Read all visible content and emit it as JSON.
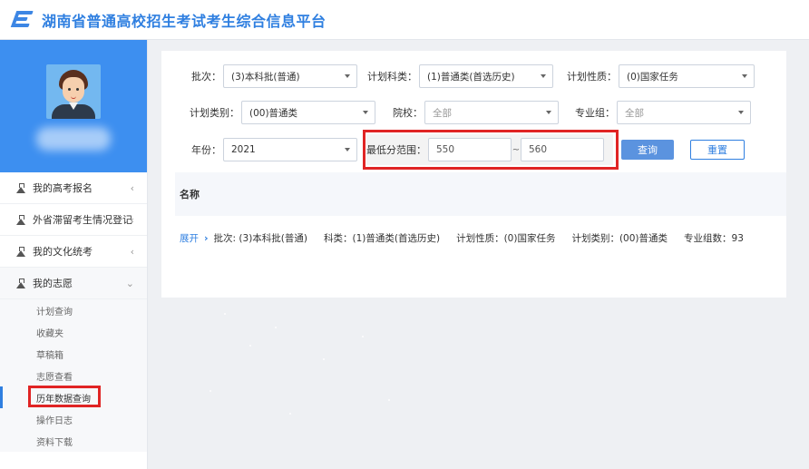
{
  "header": {
    "title": "湖南省普通高校招生考试考生综合信息平台",
    "logo_icon": "platform-logo-icon"
  },
  "sidebar": {
    "menu": [
      {
        "label": "我的高考报名",
        "arrow": "‹"
      },
      {
        "label": "外省滞留考生情况登记",
        "arrow": "‹"
      },
      {
        "label": "我的文化统考",
        "arrow": "‹"
      },
      {
        "label": "我的志愿",
        "arrow": "⌄"
      }
    ],
    "submenu": [
      "计划查询",
      "收藏夹",
      "草稿箱",
      "志愿查看",
      "历年数据查询",
      "操作日志",
      "资料下载"
    ]
  },
  "filters": {
    "batch_label": "批次：",
    "batch_value": "(3)本科批(普通)",
    "subject_label": "计划科类：",
    "subject_value": "(1)普通类(首选历史)",
    "nature_label": "计划性质：",
    "nature_value": "(0)国家任务",
    "category_label": "计划类别：",
    "category_value": "(00)普通类",
    "school_label": "院校：",
    "school_value": "全部",
    "group_label": "专业组：",
    "group_value": "全部",
    "year_label": "年份：",
    "year_value": "2021",
    "score_label": "最低分范围：",
    "score_min": "550",
    "score_sep": "~",
    "score_max": "560",
    "query_button": "查询",
    "reset_button": "重置"
  },
  "results": {
    "header": "名称",
    "expand": "展开",
    "chevron": "›",
    "batch": "批次: (3)本科批(普通)",
    "subject": "科类：(1)普通类(首选历史)",
    "nature": "计划性质：(0)国家任务",
    "category": "计划类别：(00)普通类",
    "group_count": "专业组数：93"
  },
  "colors": {
    "brand": "#2f7fe0",
    "sidebar_profile": "#3d8ff0",
    "highlight": "#e02424",
    "primary_button": "#5b93df"
  }
}
